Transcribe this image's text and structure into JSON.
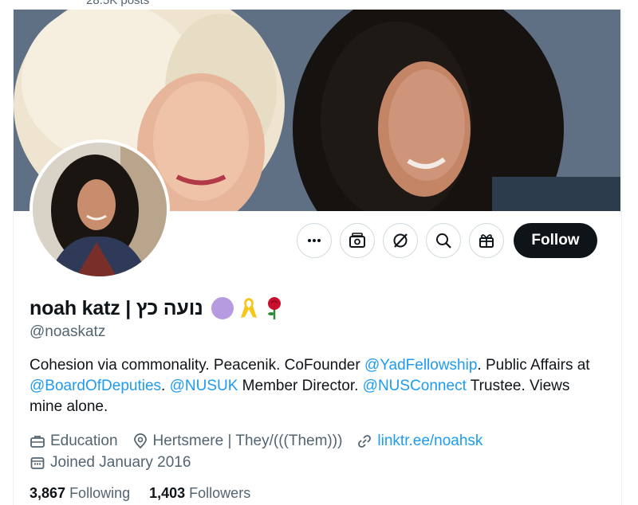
{
  "header": {
    "post_count": "28.5K posts"
  },
  "profile": {
    "display_name": "noah katz | נועה כץ",
    "handle": "@noaskatz",
    "badges": [
      "purple-circle",
      "yellow-ribbon-icon",
      "rose-icon"
    ],
    "bio": {
      "part1": "Cohesion via commonality. Peacenik. CoFounder ",
      "mention1": "@YadFellowship",
      "part2": ". Public Affairs at ",
      "mention2": "@BoardOfDeputies",
      "part3": ". ",
      "mention3": "@NUSUK",
      "part4": " Member Director. ",
      "mention4": "@NUSConnect",
      "part5": " Trustee. Views mine alone."
    },
    "category": "Education",
    "location": "Hertsmere | They/(((Them)))",
    "website": "linktr.ee/noahsk",
    "joined": "Joined January 2016",
    "following_count": "3,867",
    "following_label": "Following",
    "followers_count": "1,403",
    "followers_label": "Followers"
  },
  "actions": {
    "icons": [
      "more-icon",
      "subscriptions-icon",
      "grok-icon",
      "search-icon",
      "gift-icon"
    ],
    "follow_label": "Follow"
  },
  "colors": {
    "accent": "#1d9bf0",
    "text": "#0f1419",
    "muted": "#536471",
    "badge": "#b79be0"
  }
}
